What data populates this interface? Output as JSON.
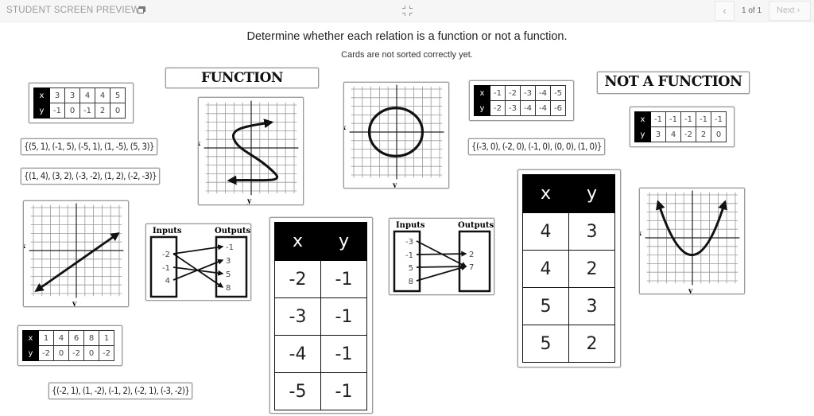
{
  "topbar": {
    "title": "STUDENT SCREEN PREVIEW",
    "icons": {
      "copy": "copy-window-icon",
      "collapse": "collapse-icon",
      "prev": "chevron-left-icon",
      "next": "chevron-right-icon"
    },
    "page_indicator": "1 of 1",
    "prev_label": "‹",
    "next_label": "Next ›"
  },
  "instructions": {
    "prompt": "Determine whether each relation is a function or not a function.",
    "status": "Cards are not sorted correctly yet."
  },
  "categories": [
    {
      "label": "FUNCTION"
    },
    {
      "label": "NOT A FUNCTION"
    }
  ],
  "cards": {
    "table_1": {
      "x": [
        "3",
        "3",
        "4",
        "4",
        "5"
      ],
      "y": [
        "-1",
        "0",
        "-1",
        "2",
        "0"
      ],
      "header_x": "x",
      "header_y": "y"
    },
    "table_2": {
      "x": [
        "-1",
        "-2",
        "-3",
        "-4",
        "-5"
      ],
      "y": [
        "-2",
        "-3",
        "-4",
        "-4",
        "-6"
      ],
      "header_x": "x",
      "header_y": "y"
    },
    "table_3": {
      "x": [
        "-1",
        "-1",
        "-1",
        "-1",
        "-1"
      ],
      "y": [
        "3",
        "4",
        "-2",
        "2",
        "0"
      ],
      "header_x": "x",
      "header_y": "y"
    },
    "table_4": {
      "x": [
        "1",
        "4",
        "6",
        "8",
        "1"
      ],
      "y": [
        "-2",
        "0",
        "-2",
        "0",
        "-2"
      ],
      "header_x": "x",
      "header_y": "y"
    },
    "set_1": "{(5, 1), (-1, 5), (-5, 1), (1, -5), (5, 3)}",
    "set_2": "{(1, 4), (3, 2), (-3, -2), (1, 2), (-2, -3)}",
    "set_3": "{(-3, 0), (-2, 0), (-1, 0), (0, 0), (1, 0)}",
    "set_4": "{(-2, 1), (1, -2), (-1, 2), (-2, 1), (-3, -2)}",
    "big_table_1": {
      "headers": [
        "x",
        "y"
      ],
      "rows": [
        [
          "-2",
          "-1"
        ],
        [
          "-3",
          "-1"
        ],
        [
          "-4",
          "-1"
        ],
        [
          "-5",
          "-1"
        ]
      ]
    },
    "big_table_2": {
      "headers": [
        "x",
        "y"
      ],
      "rows": [
        [
          "4",
          "3"
        ],
        [
          "4",
          "2"
        ],
        [
          "5",
          "3"
        ],
        [
          "5",
          "2"
        ]
      ]
    },
    "mapping_1": {
      "inputs_label": "Inputs",
      "outputs_label": "Outputs",
      "inputs": [
        "-2",
        "-1",
        "4"
      ],
      "outputs": [
        "-1",
        "3",
        "5",
        "8"
      ]
    },
    "mapping_2": {
      "inputs_label": "Inputs",
      "outputs_label": "Outputs",
      "inputs": [
        "-3",
        "-1",
        "5",
        "8"
      ],
      "outputs": [
        "2",
        "7"
      ]
    },
    "graphs": {
      "axis_x_label": "x",
      "axis_y_label": "y",
      "graph_1": "s-curve",
      "graph_2": "circle",
      "graph_3": "line",
      "graph_4": "parabola"
    }
  }
}
